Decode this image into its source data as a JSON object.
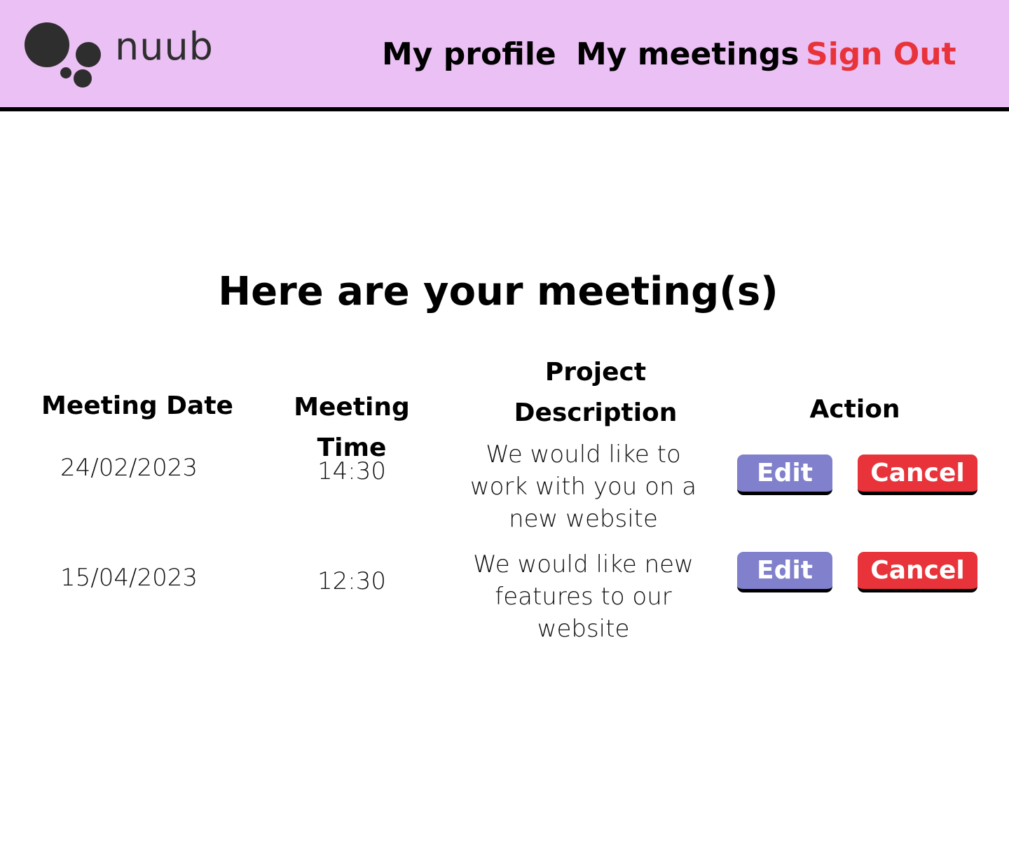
{
  "header": {
    "logo_text": "nuub",
    "nav": {
      "profile": "My profile",
      "meetings": "My meetings",
      "signout": "Sign Out"
    }
  },
  "colors": {
    "header_bg": "#ebc0f4",
    "signout": "#e8333a",
    "edit_button": "#8080cc",
    "cancel_button": "#e8333a"
  },
  "main": {
    "title": "Here are your meeting(s)",
    "table": {
      "headers": {
        "date": "Meeting Date",
        "time": "Meeting Time",
        "description": "Project Description",
        "action": "Action"
      },
      "rows": [
        {
          "date": "24/02/2023",
          "time": "14:30",
          "description": "We would like to work with you on a new website",
          "edit_label": "Edit",
          "cancel_label": "Cancel"
        },
        {
          "date": "15/04/2023",
          "time": "12:30",
          "description": "We would like new features to our website",
          "edit_label": "Edit",
          "cancel_label": "Cancel"
        }
      ]
    }
  }
}
